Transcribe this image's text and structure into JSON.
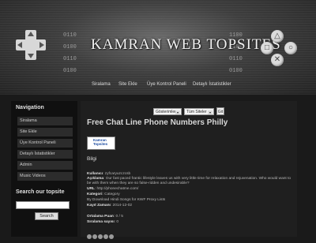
{
  "header": {
    "logo_text": "KAMRAN WEB TOPSITES",
    "bits_left": [
      "0110",
      "0100",
      "0110",
      "0100"
    ],
    "bits_right": [
      "1100",
      "0100",
      "0110",
      "0100"
    ],
    "button_glyphs": {
      "triangle": "△",
      "square": "□",
      "cross": "✕",
      "circle": "○"
    }
  },
  "nav": {
    "items": [
      "Siralama",
      "Site Ekle",
      "Üye Kontrol Paneli",
      "Detaylı İstatistikler"
    ]
  },
  "sidebar": {
    "heading": "Navigation",
    "items": [
      "Siralama",
      "Site Ekle",
      "Üye Kontrol Paneli",
      "Detaylı İstatistikler",
      "Admin",
      "Music Videos"
    ],
    "search_heading": "Search our topsite",
    "search_button": "Search",
    "search_value": ""
  },
  "filters": {
    "select1": "Gösterimler",
    "select2": "Tüm Siteler",
    "go_label": "Git"
  },
  "listing": {
    "title": "Free Chat Line Phone Numbers Philly",
    "badge_text": "Kamran Topsites",
    "section_label": "Bilgi",
    "rows": [
      {
        "label": "Kullanıcı",
        "value": ": zyfcaryuzczcsb"
      },
      {
        "label": "Açıklama",
        "value": ": Our fast paced frantic lifestyle leaves us with very little time for relaxation and rejuvenation. Who would want to"
      },
      {
        "label": "",
        "value": "be with them when they are so false-ridden and undesirable?"
      },
      {
        "label": "URL",
        "value": ": http://phonechatme.com/"
      },
      {
        "label": "Kategori",
        "value": ": Category"
      },
      {
        "label": "",
        "value": "By Download Hindi Songs for KWF Proxy Lists"
      },
      {
        "label": "Kayıt Zamanı",
        "value": ": 2014-12-02"
      },
      {
        "label": "Ortalama Puan",
        "value": ": 0 / 5"
      },
      {
        "label": "Sıralama sayısı",
        "value": ": 0"
      }
    ],
    "rating_stars": 5
  },
  "colors": {
    "background": "#1a1a1a",
    "panel": "#1f1f1f",
    "sidebar_item": "#2c2c2c"
  }
}
